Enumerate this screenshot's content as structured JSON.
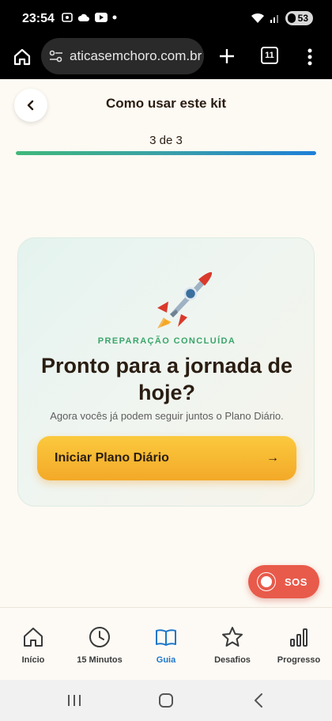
{
  "status_bar": {
    "time": "23:54",
    "battery": "53"
  },
  "browser": {
    "url": "aticasemchoro.com.br",
    "tab_count": "11"
  },
  "header": {
    "title": "Como usar este kit",
    "step": "3 de 3",
    "progress": 1.0
  },
  "card": {
    "kicker": "PREPARAÇÃO CONCLUÍDA",
    "title": "Pronto para a jornada de hoje?",
    "subtitle": "Agora vocês já podem seguir juntos o Plano Diário.",
    "cta_label": "Iniciar Plano Diário",
    "cta_arrow": "→"
  },
  "sos": {
    "label": "SOS"
  },
  "bottom_nav": {
    "items": [
      {
        "label": "Início",
        "icon": "home-icon",
        "active": false
      },
      {
        "label": "15 Minutos",
        "icon": "clock-icon",
        "active": false
      },
      {
        "label": "Guia",
        "icon": "book-icon",
        "active": true
      },
      {
        "label": "Desafios",
        "icon": "star-icon",
        "active": false
      },
      {
        "label": "Progresso",
        "icon": "bar-chart-icon",
        "active": false
      }
    ]
  },
  "colors": {
    "accent_blue": "#1d77c9",
    "cta_yellow": "#f3a928",
    "kicker_green": "#3aa66a",
    "sos_red": "#e85a4a"
  }
}
